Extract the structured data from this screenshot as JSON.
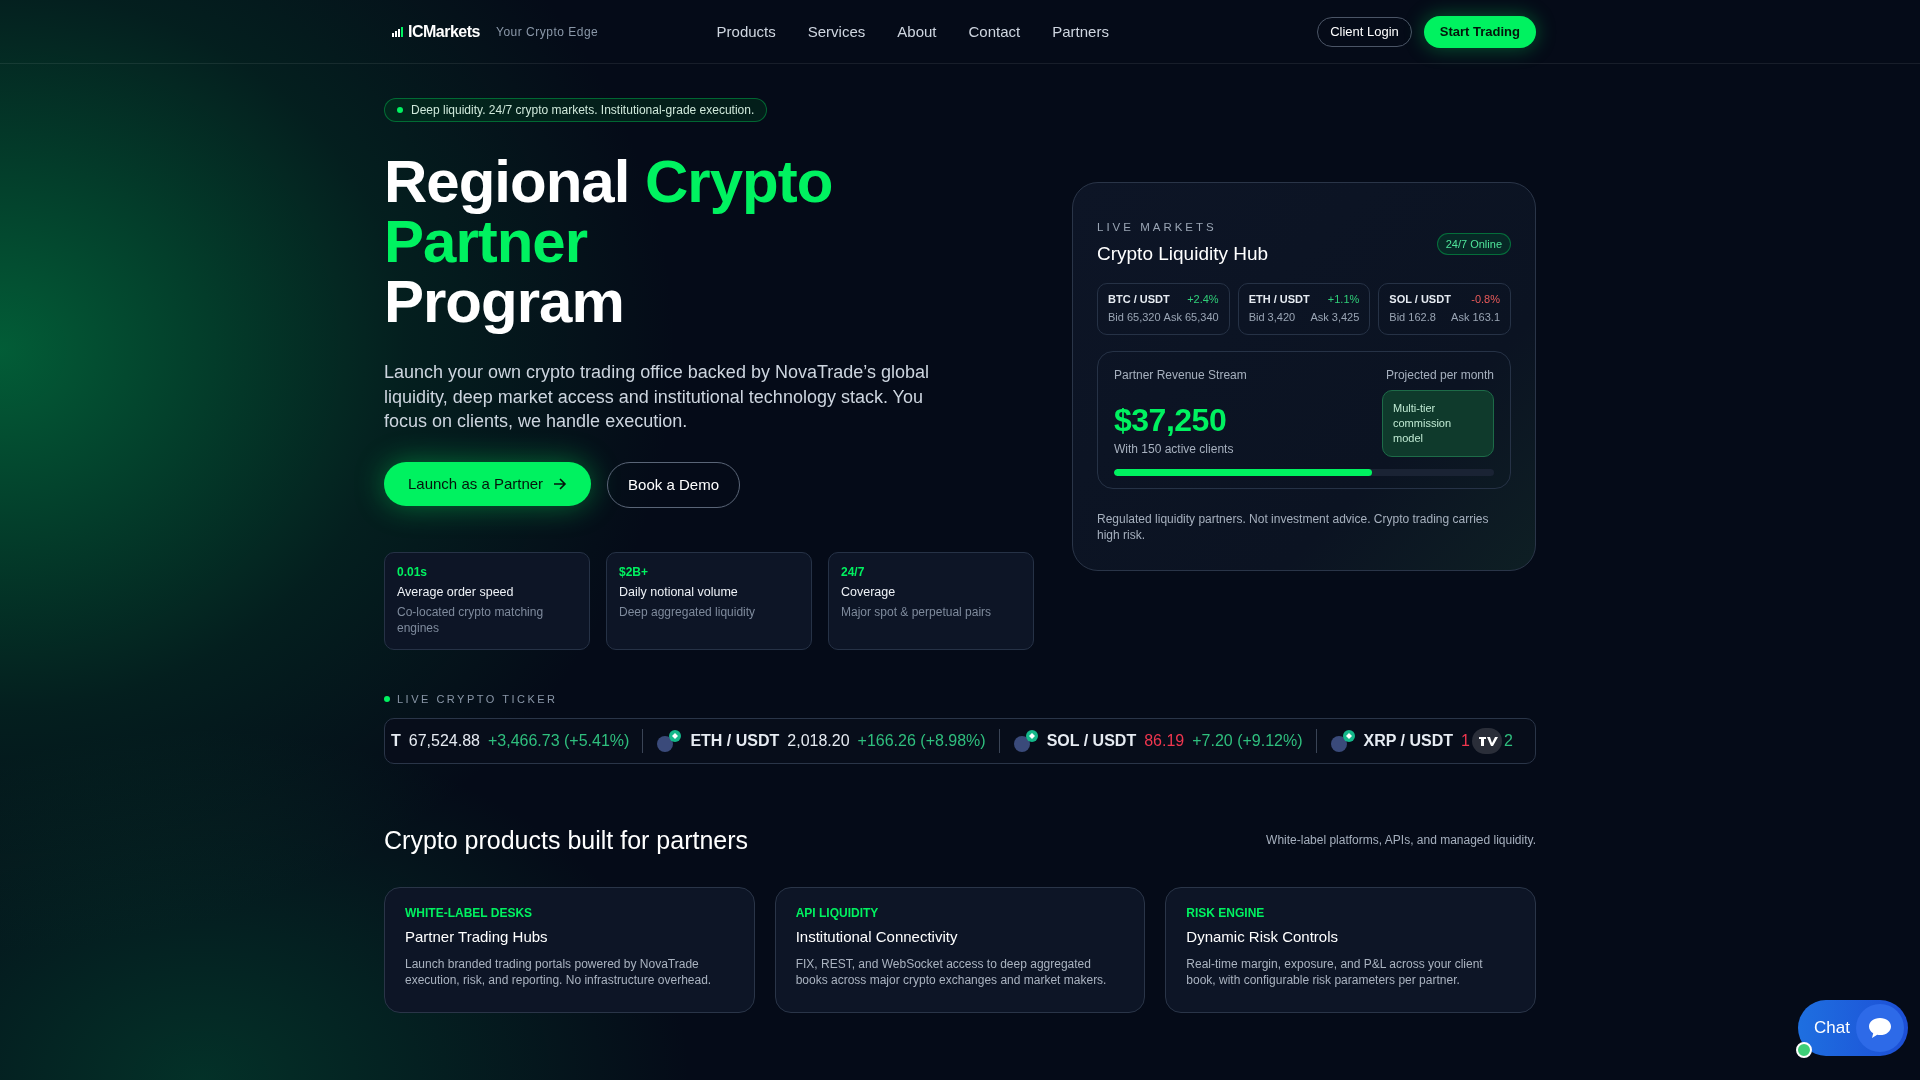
{
  "header": {
    "logo": "ICMarkets",
    "tagline": "Your Crypto Edge",
    "nav": [
      {
        "label": "Products"
      },
      {
        "label": "Services"
      },
      {
        "label": "About"
      },
      {
        "label": "Contact"
      },
      {
        "label": "Partners"
      }
    ],
    "login": "Client Login",
    "cta": "Start Trading"
  },
  "hero": {
    "badge": "Deep liquidity. 24/7 crypto markets. Institutional-grade execution.",
    "title_lines": [
      [
        {
          "text": "Regional",
          "accent": false
        },
        {
          "text": "Crypto",
          "accent": true
        }
      ],
      [
        {
          "text": "Partner",
          "accent": true
        }
      ],
      [
        {
          "text": "Program",
          "accent": false
        }
      ]
    ],
    "lead": "Launch your own crypto trading office backed by NovaTrade’s global liquidity, deep market access and institutional technology stack. You focus on clients, we handle execution.",
    "primary_button": "Launch as a Partner",
    "secondary_button": "Book a Demo",
    "stats": [
      {
        "value": "0.01s",
        "label": "Average order speed",
        "note": "Co-located crypto matching engines"
      },
      {
        "value": "$2B+",
        "label": "Daily notional volume",
        "note": "Deep aggregated liquidity"
      },
      {
        "value": "24/7",
        "label": "Coverage",
        "note": "Major spot & perpetual pairs"
      }
    ]
  },
  "live_card": {
    "eyebrow": "LIVE MARKETS",
    "title": "Crypto Liquidity Hub",
    "status": "24/7 Online",
    "pairs": [
      {
        "pair": "BTC / USDT",
        "change": "+2.4%",
        "negative": false,
        "bid": "Bid 65,320",
        "ask": "Ask 65,340"
      },
      {
        "pair": "ETH / USDT",
        "change": "+1.1%",
        "negative": false,
        "bid": "Bid 3,420",
        "ask": "Ask 3,425"
      },
      {
        "pair": "SOL / USDT",
        "change": "-0.8%",
        "negative": true,
        "bid": "Bid 162.8",
        "ask": "Ask 163.1"
      }
    ],
    "revenue": {
      "label": "Partner Revenue Stream",
      "period": "Projected per month",
      "amount": "$37,250",
      "clients": "With 150 active clients",
      "model": "Multi-tier commission model",
      "level": 0.68
    },
    "disclaimer": "Regulated liquidity partners. Not investment advice. Crypto trading carries high risk."
  },
  "ticker": {
    "label": "LIVE CRYPTO TICKER",
    "items": [
      {
        "pair": "T",
        "price": "67,524.88",
        "change": "+3,466.73 (+5.41%)",
        "price_down": false,
        "icon": false
      },
      {
        "pair": "ETH / USDT",
        "price": "2,018.20",
        "change": "+166.26 (+8.98%)",
        "price_down": false,
        "icon": true
      },
      {
        "pair": "SOL / USDT",
        "price": "86.19",
        "change": "+7.20 (+9.12%)",
        "price_down": true,
        "icon": true
      },
      {
        "pair": "XRP / USDT",
        "price": "1",
        "change": "2",
        "price_down": true,
        "icon": true
      }
    ]
  },
  "products": {
    "title": "Crypto products built for partners",
    "subtitle": "White-label platforms, APIs, and managed liquidity.",
    "cards": [
      {
        "tag": "WHITE-LABEL DESKS",
        "title": "Partner Trading Hubs",
        "text": "Launch branded trading portals powered by NovaTrade execution, risk, and reporting. No infrastructure overhead."
      },
      {
        "tag": "API LIQUIDITY",
        "title": "Institutional Connectivity",
        "text": "FIX, REST, and WebSocket access to deep aggregated books across major crypto exchanges and market makers."
      },
      {
        "tag": "RISK ENGINE",
        "title": "Dynamic Risk Controls",
        "text": "Real-time margin, exposure, and P&L across your client book, with configurable risk parameters per partner."
      }
    ]
  },
  "chat": {
    "label": "Chat",
    "online": true
  }
}
